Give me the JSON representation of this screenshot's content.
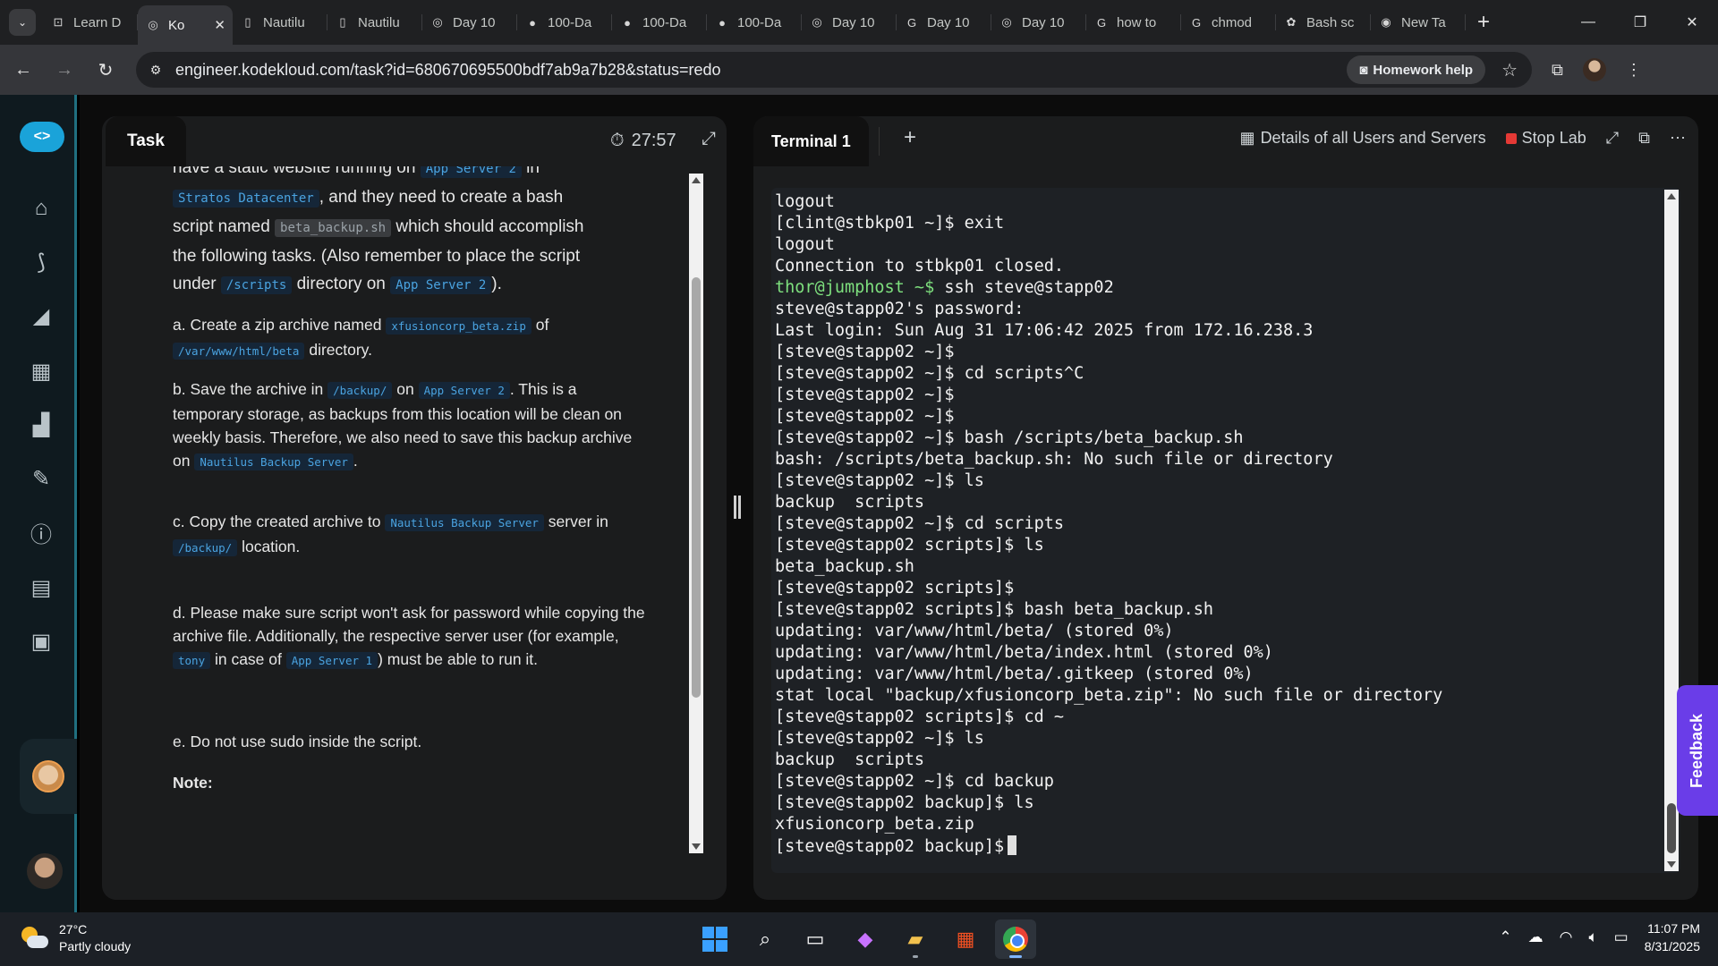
{
  "browser": {
    "tabs": [
      {
        "title": "Learn D",
        "icon": "kodekloud-learn-icon",
        "active": false
      },
      {
        "title": "Ko",
        "icon": "kodekloud-icon",
        "active": true
      },
      {
        "title": "Nautilu",
        "icon": "doc-icon",
        "active": false
      },
      {
        "title": "Nautilu",
        "icon": "doc-icon",
        "active": false
      },
      {
        "title": "Day 10",
        "icon": "kodekloud-icon",
        "active": false
      },
      {
        "title": "100-Da",
        "icon": "github-icon",
        "active": false
      },
      {
        "title": "100-Da",
        "icon": "github-icon",
        "active": false
      },
      {
        "title": "100-Da",
        "icon": "github-icon",
        "active": false
      },
      {
        "title": "Day 10",
        "icon": "kodekloud-icon",
        "active": false
      },
      {
        "title": "Day 10",
        "icon": "google-icon",
        "active": false
      },
      {
        "title": "Day 10",
        "icon": "kodekloud-icon",
        "active": false
      },
      {
        "title": "how to",
        "icon": "google-icon",
        "active": false
      },
      {
        "title": "chmod",
        "icon": "google-icon",
        "active": false
      },
      {
        "title": "Bash sc",
        "icon": "chatgpt-icon",
        "active": false
      },
      {
        "title": "New Ta",
        "icon": "chrome-icon",
        "active": false
      }
    ],
    "url": "engineer.kodekloud.com/task?id=680670695500bdf7ab9a7b28&status=redo",
    "homework_help": "Homework help"
  },
  "task": {
    "tab_label": "Task",
    "timer": "27:57",
    "intro": {
      "line0_pre": "have a static website running on ",
      "line0_code": "App Server 2",
      "line0_post": " in",
      "dc_code": "Stratos Datacenter",
      "line1_post": ", and they need to create a bash",
      "line2_pre": "script named ",
      "script_code": "beta_backup.sh",
      "line2_post": " which should accomplish",
      "line3": "the following tasks. (Also remember to place the script",
      "line4_pre": "under ",
      "dir_code": "/scripts",
      "line4_mid": " directory on ",
      "server_code": "App Server 2",
      "line4_post": ")."
    },
    "step_a": {
      "pre": "a. Create a zip archive named ",
      "code1": "xfusioncorp_beta.zip",
      "mid": " of",
      "code2": "/var/www/html/beta",
      "post": " directory."
    },
    "step_b": {
      "pre": "b. Save the archive in ",
      "code1": "/backup/",
      "mid1": " on ",
      "code2": "App Server 2",
      "mid2": ". This is a temporary storage, as backups from this location will be clean on weekly basis. Therefore, we also need to save this backup archive on ",
      "code3": "Nautilus Backup Server",
      "post": "."
    },
    "step_c": {
      "pre": "c. Copy the created archive to ",
      "code1": "Nautilus Backup Server",
      "mid": " server in ",
      "code2": "/backup/",
      "post": " location."
    },
    "step_d": {
      "pre": "d. Please make sure script won't ask for password while copying the archive file. Additionally, the respective server user (for example, ",
      "code1": "tony",
      "mid": " in case of ",
      "code2": "App Server 1",
      "post": ") must be able to run it."
    },
    "step_e": "e. Do not use sudo inside the script.",
    "note": "Note:"
  },
  "terminal": {
    "tab_label": "Terminal 1",
    "details_label": "Details of all Users and Servers",
    "stop_label": "Stop Lab",
    "lines": [
      {
        "text": "logout"
      },
      {
        "text": "[clint@stbkp01 ~]$ exit"
      },
      {
        "text": "logout"
      },
      {
        "text": "Connection to stbkp01 closed."
      },
      {
        "prompt": "thor@jumphost ~$",
        "text": " ssh steve@stapp02"
      },
      {
        "text": "steve@stapp02's password:"
      },
      {
        "text": "Last login: Sun Aug 31 17:06:42 2025 from 172.16.238.3"
      },
      {
        "text": "[steve@stapp02 ~]$"
      },
      {
        "text": "[steve@stapp02 ~]$ cd scripts^C"
      },
      {
        "text": "[steve@stapp02 ~]$"
      },
      {
        "text": "[steve@stapp02 ~]$"
      },
      {
        "text": "[steve@stapp02 ~]$ bash /scripts/beta_backup.sh"
      },
      {
        "text": "bash: /scripts/beta_backup.sh: No such file or directory"
      },
      {
        "text": "[steve@stapp02 ~]$ ls"
      },
      {
        "text": "backup  scripts"
      },
      {
        "text": "[steve@stapp02 ~]$ cd scripts"
      },
      {
        "text": "[steve@stapp02 scripts]$ ls"
      },
      {
        "text": "beta_backup.sh"
      },
      {
        "text": "[steve@stapp02 scripts]$"
      },
      {
        "text": "[steve@stapp02 scripts]$ bash beta_backup.sh"
      },
      {
        "text": "updating: var/www/html/beta/ (stored 0%)"
      },
      {
        "text": "updating: var/www/html/beta/index.html (stored 0%)"
      },
      {
        "text": "updating: var/www/html/beta/.gitkeep (stored 0%)"
      },
      {
        "text": "stat local \"backup/xfusioncorp_beta.zip\": No such file or directory"
      },
      {
        "text": "[steve@stapp02 scripts]$ cd ~"
      },
      {
        "text": "[steve@stapp02 ~]$ ls"
      },
      {
        "text": "backup  scripts"
      },
      {
        "text": "[steve@stapp02 ~]$ cd backup"
      },
      {
        "text": "[steve@stapp02 backup]$ ls"
      },
      {
        "text": "xfusioncorp_beta.zip"
      },
      {
        "text": "[steve@stapp02 backup]$",
        "cursor": true
      }
    ]
  },
  "feedback_label": "Feedback",
  "taskbar": {
    "weather_temp": "27°C",
    "weather_desc": "Partly cloudy",
    "time": "11:07 PM",
    "date": "8/31/2025"
  },
  "colors": {
    "accent": "#1aa3d9",
    "prompt_green": "#7ee07e",
    "stop_red": "#e53935",
    "feedback_purple": "#6a3de8"
  }
}
